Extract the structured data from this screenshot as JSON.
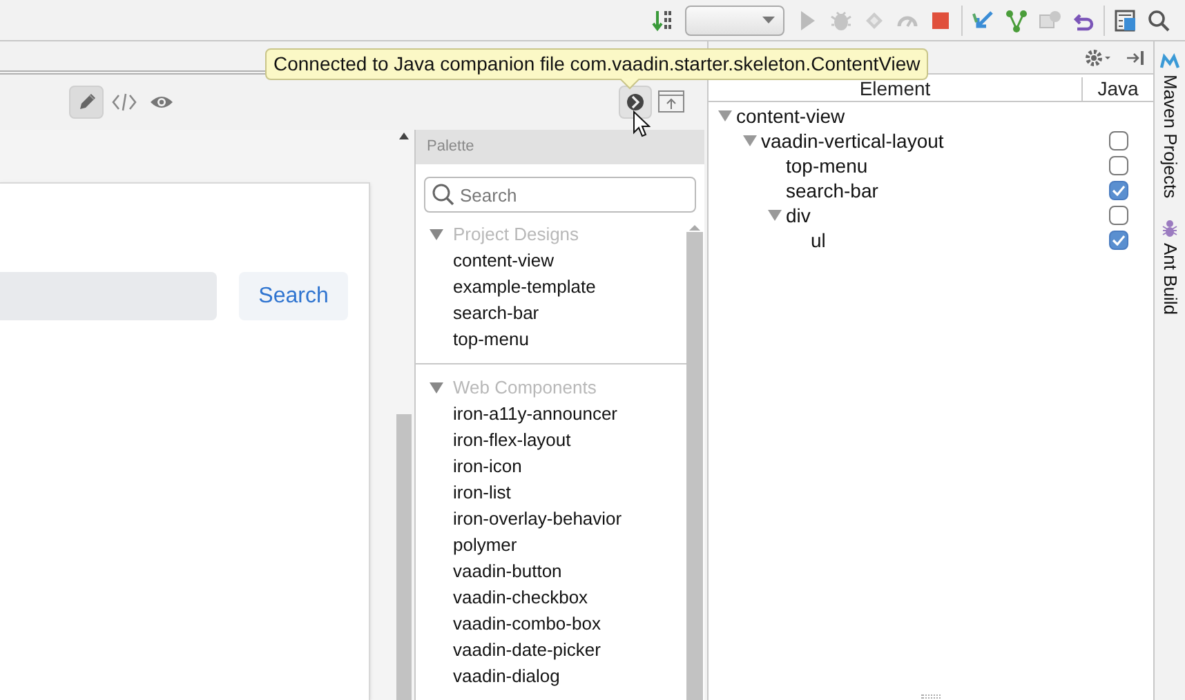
{
  "tooltip": {
    "text": "Connected to Java companion file com.vaadin.starter.skeleton.ContentView"
  },
  "editor_modes": [
    {
      "kind": "design",
      "selected": true
    },
    {
      "kind": "code",
      "selected": false
    },
    {
      "kind": "preview",
      "selected": false
    }
  ],
  "canvas": {
    "search_button": "Search"
  },
  "palette": {
    "title": "Palette",
    "search": {
      "placeholder": "Search"
    },
    "sections": [
      {
        "title": "Project Designs",
        "expanded": true,
        "items": [
          "content-view",
          "example-template",
          "search-bar",
          "top-menu"
        ]
      },
      {
        "title": "Web Components",
        "expanded": true,
        "items": [
          "iron-a11y-announcer",
          "iron-flex-layout",
          "iron-icon",
          "iron-list",
          "iron-overlay-behavior",
          "polymer",
          "vaadin-button",
          "vaadin-checkbox",
          "vaadin-combo-box",
          "vaadin-date-picker",
          "vaadin-dialog"
        ]
      }
    ]
  },
  "outline": {
    "columns": [
      "Element",
      "Java"
    ],
    "tree": [
      {
        "name": "content-view",
        "expanded": true,
        "children": [
          {
            "name": "vaadin-vertical-layout",
            "expanded": true,
            "java": false,
            "children": [
              {
                "name": "top-menu",
                "java": false
              },
              {
                "name": "search-bar",
                "java": true
              },
              {
                "name": "div",
                "expanded": true,
                "java": false,
                "children": [
                  {
                    "name": "ul",
                    "java": true
                  }
                ]
              }
            ]
          }
        ]
      }
    ]
  },
  "side_tabs": [
    {
      "label": "Maven Projects",
      "kind": "maven"
    },
    {
      "label": "Ant Build",
      "kind": "ant"
    }
  ]
}
